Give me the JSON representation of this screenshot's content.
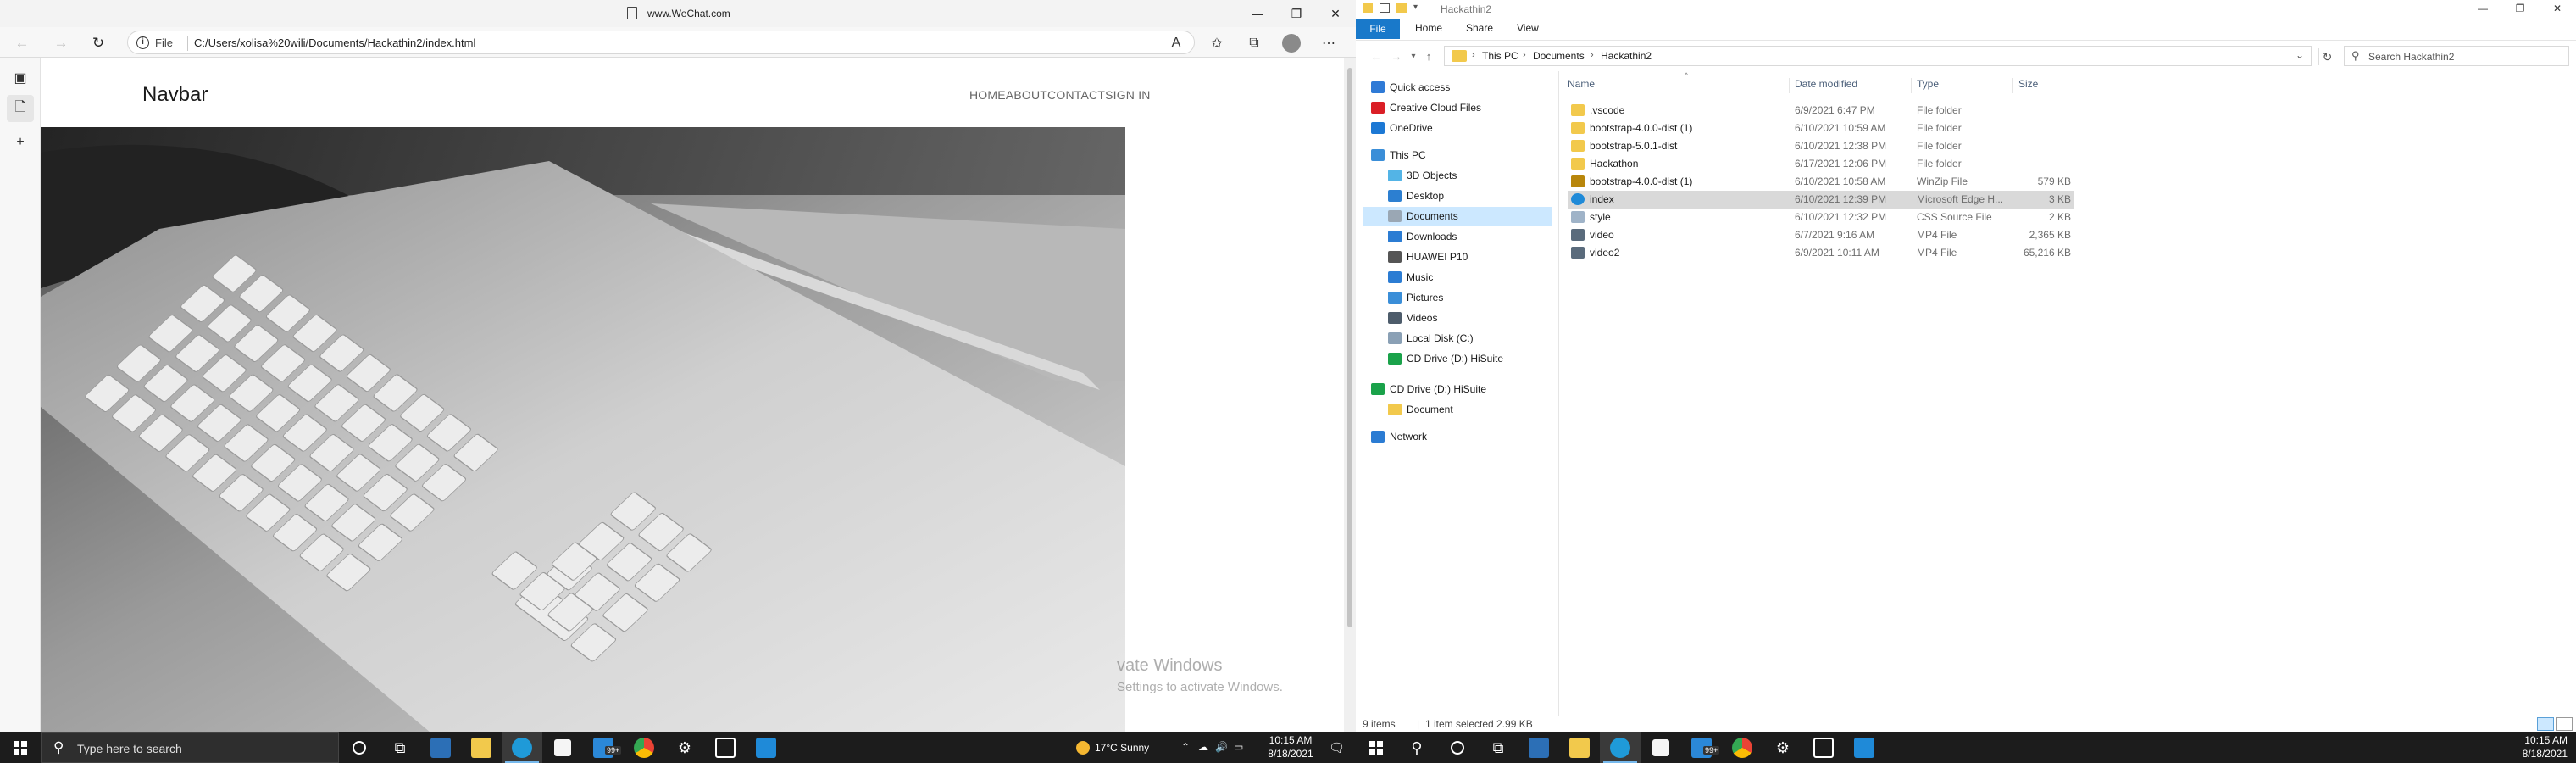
{
  "edge": {
    "window_title": "www.WeChat.com",
    "protocol": "File",
    "url": "C:/Users/xolisa%20wili/Documents/Hackathin2/index.html",
    "window_controls": [
      "—",
      "❐",
      "✕"
    ],
    "page": {
      "brand": "Navbar",
      "nav_links": [
        "HOME",
        "ABOUT",
        "CONTACT",
        "SIGN IN"
      ]
    },
    "watermark": {
      "line1": "vate Windows",
      "line2": "Settings to activate Windows."
    }
  },
  "explorer": {
    "window_title": "Hackathin2",
    "ribbon_tabs": [
      "File",
      "Home",
      "Share",
      "View"
    ],
    "breadcrumb": [
      "This PC",
      "Documents",
      "Hackathin2"
    ],
    "search_placeholder": "Search Hackathin2",
    "columns": [
      "Name",
      "Date modified",
      "Type",
      "Size"
    ],
    "nav_items": [
      {
        "label": "Quick access",
        "icon": "star-icon",
        "color": "#2f7ad6"
      },
      {
        "label": "Creative Cloud Files",
        "icon": "creative-cloud-icon",
        "color": "#da1f26"
      },
      {
        "label": "OneDrive",
        "icon": "cloud-icon",
        "color": "#1c78d4"
      },
      {
        "label": "This PC",
        "icon": "computer-icon",
        "color": "#3a8ed8"
      },
      {
        "label": "3D Objects",
        "icon": "cube-icon",
        "color": "#53b4e6"
      },
      {
        "label": "Desktop",
        "icon": "desktop-icon",
        "color": "#2c7fd1"
      },
      {
        "label": "Documents",
        "icon": "documents-icon",
        "color": "#9aa7b4"
      },
      {
        "label": "Downloads",
        "icon": "download-icon",
        "color": "#2b7cd3"
      },
      {
        "label": "HUAWEI P10",
        "icon": "phone-icon",
        "color": "#555555"
      },
      {
        "label": "Music",
        "icon": "music-icon",
        "color": "#2b7cd3"
      },
      {
        "label": "Pictures",
        "icon": "pictures-icon",
        "color": "#3a8ed8"
      },
      {
        "label": "Videos",
        "icon": "video-icon",
        "color": "#4d5c6b"
      },
      {
        "label": "Local Disk (C:)",
        "icon": "disk-icon",
        "color": "#8aa0b5"
      },
      {
        "label": "CD Drive (D:) HiSuite",
        "icon": "cd-drive-icon",
        "color": "#1aa24a"
      },
      {
        "label": "CD Drive (D:) HiSuite",
        "icon": "cd-drive-icon",
        "color": "#1aa24a"
      },
      {
        "label": "Document",
        "icon": "folder-icon",
        "color": "#f2c94c"
      },
      {
        "label": "Network",
        "icon": "network-icon",
        "color": "#2b7cd3"
      }
    ],
    "files": [
      {
        "name": ".vscode",
        "date": "6/9/2021 6:47 PM",
        "type": "File folder",
        "size": "",
        "icon": "folder-icon",
        "color": "#f2c94c"
      },
      {
        "name": "bootstrap-4.0.0-dist (1)",
        "date": "6/10/2021 10:59 AM",
        "type": "File folder",
        "size": "",
        "icon": "folder-icon",
        "color": "#f2c94c"
      },
      {
        "name": "bootstrap-5.0.1-dist",
        "date": "6/10/2021 12:38 PM",
        "type": "File folder",
        "size": "",
        "icon": "folder-icon",
        "color": "#f2c94c"
      },
      {
        "name": "Hackathon",
        "date": "6/17/2021 12:06 PM",
        "type": "File folder",
        "size": "",
        "icon": "folder-icon",
        "color": "#f2c94c"
      },
      {
        "name": "bootstrap-4.0.0-dist (1)",
        "date": "6/10/2021 10:58 AM",
        "type": "WinZip File",
        "size": "579 KB",
        "icon": "zip-icon",
        "color": "#b8860b"
      },
      {
        "name": "index",
        "date": "6/10/2021 12:39 PM",
        "type": "Microsoft Edge H...",
        "size": "3 KB",
        "icon": "edge-html-icon",
        "color": "#1f8ad8"
      },
      {
        "name": "style",
        "date": "6/10/2021 12:32 PM",
        "type": "CSS Source File",
        "size": "2 KB",
        "icon": "css-file-icon",
        "color": "#9fb3c8"
      },
      {
        "name": "video",
        "date": "6/7/2021 9:16 AM",
        "type": "MP4 File",
        "size": "2,365 KB",
        "icon": "video-file-icon",
        "color": "#5a6b7c"
      },
      {
        "name": "video2",
        "date": "6/9/2021 10:11 AM",
        "type": "MP4 File",
        "size": "65,216 KB",
        "icon": "video-file-icon",
        "color": "#5a6b7c"
      }
    ],
    "selected_file_index": 5,
    "status": {
      "items": "9 items",
      "selected": "1 item selected  2.99 KB"
    }
  },
  "taskbar_left": {
    "search_placeholder": "Type here to search",
    "weather": "17°C  Sunny",
    "time": "10:15 AM",
    "date": "8/18/2021",
    "badge": "99+"
  },
  "taskbar_right": {
    "time": "10:15 AM",
    "date": "8/18/2021",
    "badge": "99+"
  }
}
